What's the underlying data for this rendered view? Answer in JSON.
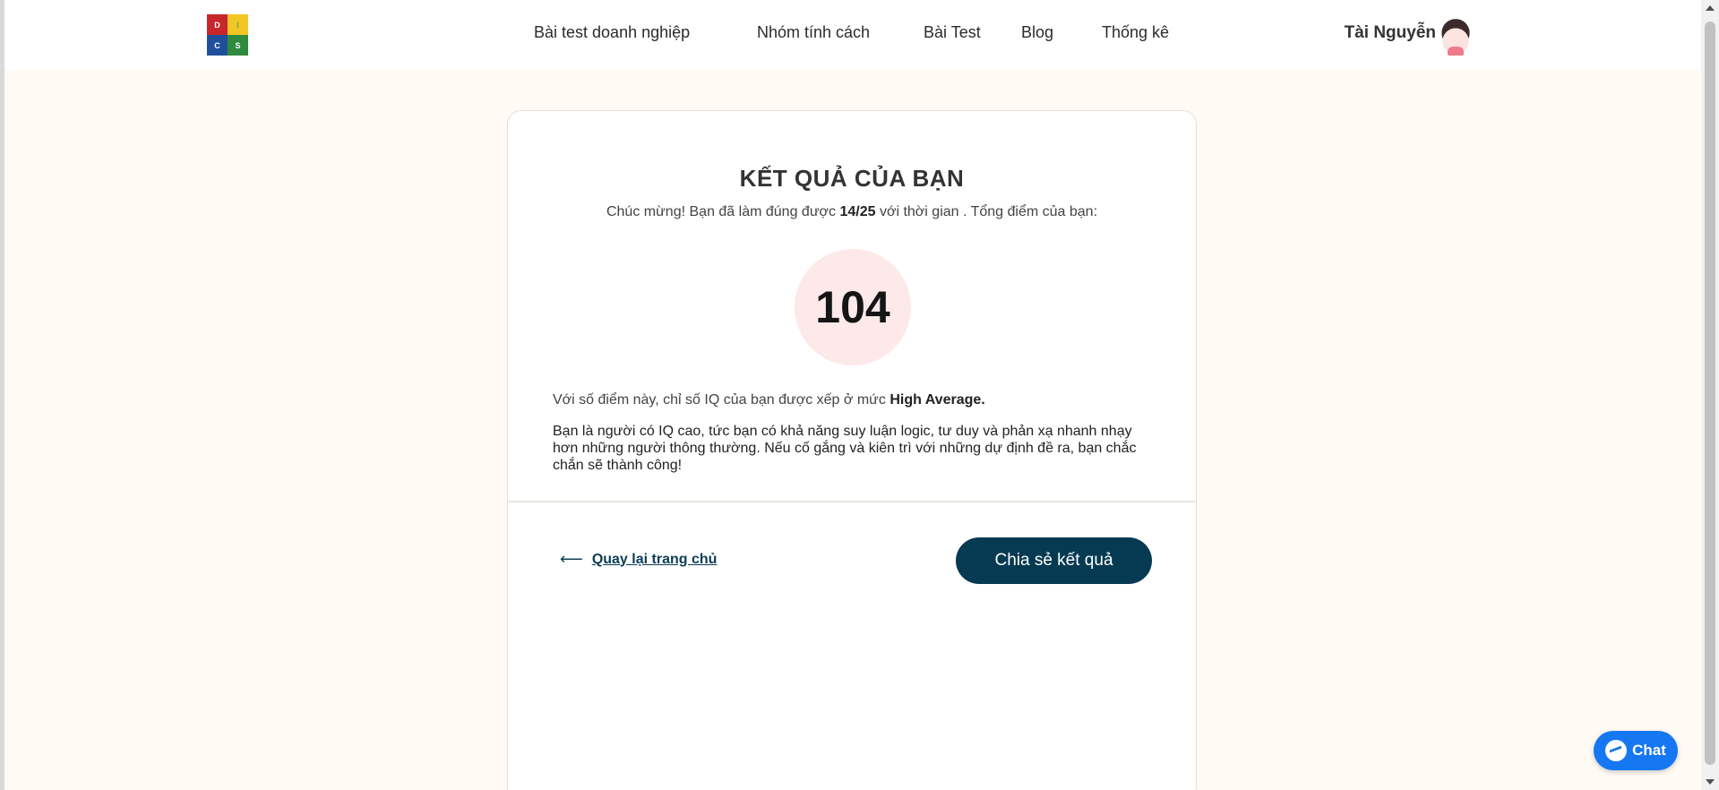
{
  "header": {
    "logo_letters": [
      "D",
      "I",
      "C",
      "S"
    ],
    "nav": [
      "Bài test doanh nghiệp",
      "Nhóm tính cách",
      "Bài Test",
      "Blog",
      "Thống kê"
    ],
    "user_name": "Tài Nguyễn"
  },
  "result": {
    "title": "KẾT QUẢ CỦA BẠN",
    "congrats_prefix": "Chúc mừng! Bạn đã làm đúng được ",
    "correct": "14/25",
    "congrats_suffix": " với thời gian . Tổng điểm của bạn:",
    "score": "104",
    "level_prefix": "Với số điểm này, chỉ số IQ của bạn được xếp ở mức ",
    "level": "High Average.",
    "description": "Bạn là người có IQ cao, tức bạn có khả năng suy luận logic, tư duy và phản xạ nhanh nhạy hơn những người thông thường. Nếu cố gắng và kiên trì với những dự định đề ra, bạn chắc chắn sẽ thành công!",
    "back_label": "Quay lại trang chủ",
    "share_label": "Chia sẻ kết quả"
  },
  "chat": {
    "label": "Chat"
  },
  "colors": {
    "page_bg": "#fffaf4",
    "primary": "#063a52",
    "score_circle": "#fde8ea",
    "chat": "#1577f2"
  }
}
